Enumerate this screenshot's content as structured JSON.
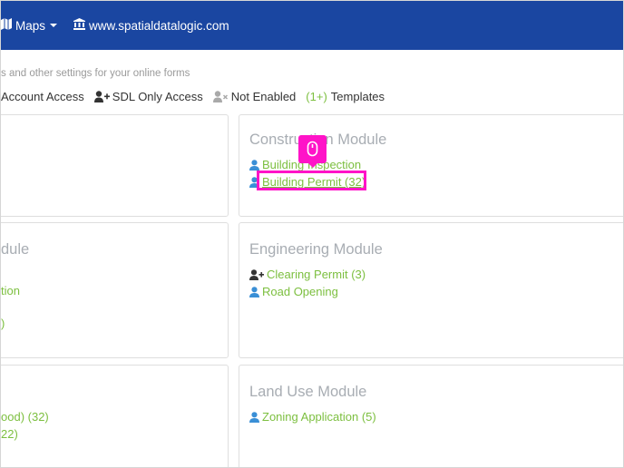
{
  "navbar": {
    "maps_label": "Maps",
    "site_label": "www.spatialdatalogic.com",
    "icons": {
      "maps": "map-icon",
      "site": "institution-icon",
      "caret": "caret-down-icon"
    }
  },
  "subtitle": "s and other settings for your online forms",
  "legend": {
    "account_access": "Account Access",
    "sdl_only": "SDL Only Access",
    "not_enabled": "Not Enabled",
    "templates_count": "(1+)",
    "templates_label": "Templates"
  },
  "cards": {
    "construction": {
      "title": "Construction Module",
      "links": [
        "Building Inspection",
        "Building Permit (32)"
      ]
    },
    "mid_left": {
      "title": "dule",
      "links": [
        "tion",
        ")"
      ]
    },
    "engineering": {
      "title": "Engineering Module",
      "links": [
        "Clearing Permit (3)",
        "Road Opening"
      ]
    },
    "bottom_left": {
      "links": [
        "ood) (32)",
        "22)"
      ]
    },
    "land_use": {
      "title": "Land Use Module",
      "links": [
        "Zoning Application (5)"
      ]
    }
  },
  "colors": {
    "navbar": "#1a46a1",
    "link": "#7cbf3f",
    "highlight": "#ff14c8",
    "user_icon": "#3a8fd6"
  }
}
